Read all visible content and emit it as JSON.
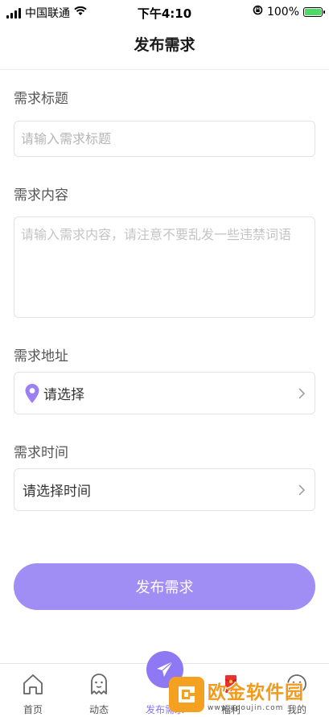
{
  "status_bar": {
    "carrier": "中国联通",
    "time": "下午4:10",
    "battery": "100%",
    "battery_level": 1.0
  },
  "header": {
    "title": "发布需求"
  },
  "form": {
    "title_label": "需求标题",
    "title_placeholder": "请输入需求标题",
    "content_label": "需求内容",
    "content_placeholder": "请输入需求内容，请注意不要乱发一些违禁词语",
    "address_label": "需求地址",
    "address_value": "请选择",
    "time_label": "需求时间",
    "time_value": "请选择时间",
    "submit_label": "发布需求"
  },
  "tabs": [
    {
      "label": "首页",
      "icon": "home-icon"
    },
    {
      "label": "动态",
      "icon": "ghost-icon"
    },
    {
      "label": "发布需求",
      "icon": "paper-plane-icon",
      "active": true
    },
    {
      "label": "福利",
      "icon": "red-envelope-icon"
    },
    {
      "label": "我的",
      "icon": "smiley-icon"
    }
  ],
  "watermark": {
    "title": "欧金软件园",
    "url": "www.apoujin.com"
  },
  "colors": {
    "accent": "#8f78f3",
    "submit_button": "#a08ef4",
    "pin": "#9a7ff5"
  }
}
